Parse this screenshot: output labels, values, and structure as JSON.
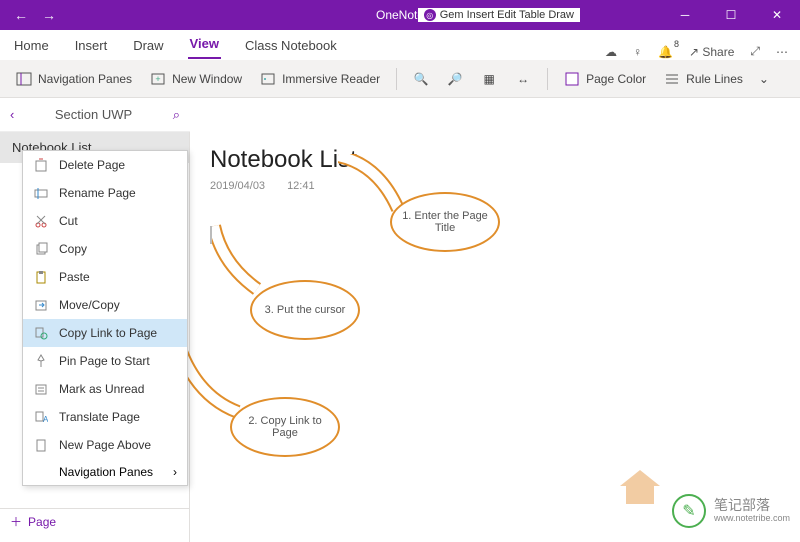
{
  "titlebar": {
    "app_name": "OneNote",
    "gem_text": "Gem  Insert  Edit  Table  Draw"
  },
  "tabs": {
    "items": [
      "Home",
      "Insert",
      "Draw",
      "View",
      "Class Notebook"
    ],
    "active_index": 3,
    "share": "Share",
    "bell_badge": "8"
  },
  "ribbon": {
    "nav_panes": "Navigation Panes",
    "new_window": "New Window",
    "immersive": "Immersive Reader",
    "page_color": "Page Color",
    "rule_lines": "Rule Lines"
  },
  "section": {
    "name": "Section UWP"
  },
  "pages": {
    "current": "Notebook List"
  },
  "ctx_menu": {
    "items": [
      {
        "label": "Delete Page",
        "icon": "delete"
      },
      {
        "label": "Rename Page",
        "icon": "rename"
      },
      {
        "label": "Cut",
        "icon": "cut"
      },
      {
        "label": "Copy",
        "icon": "copy"
      },
      {
        "label": "Paste",
        "icon": "paste"
      },
      {
        "label": "Move/Copy",
        "icon": "move"
      },
      {
        "label": "Copy Link to Page",
        "icon": "link",
        "sel": true
      },
      {
        "label": "Pin Page to Start",
        "icon": "pin"
      },
      {
        "label": "Mark as Unread",
        "icon": "unread"
      },
      {
        "label": "Translate Page",
        "icon": "translate"
      },
      {
        "label": "New Page Above",
        "icon": "newpage"
      }
    ],
    "nav_panes": "Navigation Panes"
  },
  "page": {
    "title": "Notebook List",
    "date": "2019/04/03",
    "time": "12:41"
  },
  "callouts": {
    "c1": "1.  Enter the Page Title",
    "c2": "2.  Copy Link to Page",
    "c3": "3.  Put the cursor"
  },
  "footer": {
    "add_page": "Page"
  },
  "watermark": {
    "cn": "笔记部落",
    "url": "www.notetribe.com"
  }
}
